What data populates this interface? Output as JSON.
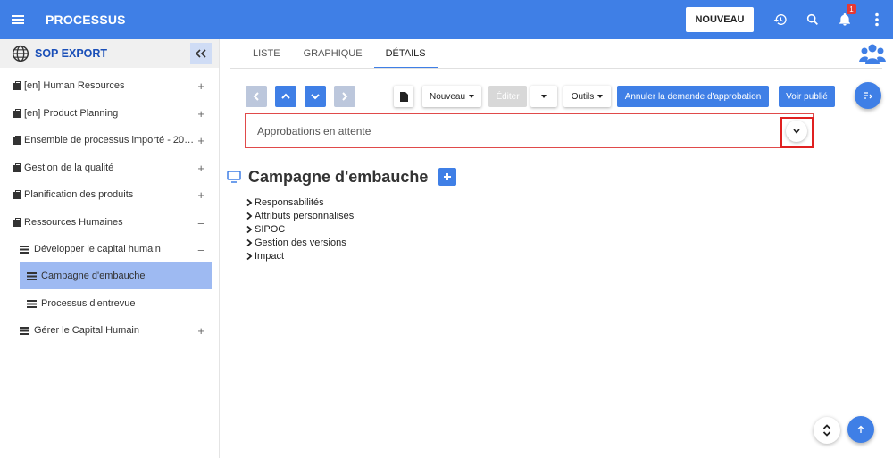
{
  "header": {
    "title": "PROCESSUS",
    "new_button": "NOUVEAU",
    "notification_count": "1",
    "icons": [
      "menu-icon",
      "history-icon",
      "search-icon",
      "bell-icon",
      "more-vert-icon"
    ]
  },
  "sidebar": {
    "title": "SOP EXPORT",
    "items": [
      {
        "label": "[en] Human Resources",
        "toggle": "+"
      },
      {
        "label": "[en] Product Planning",
        "toggle": "+"
      },
      {
        "label": "Ensemble de processus importé - 202…",
        "toggle": "+"
      },
      {
        "label": "Gestion de la qualité",
        "toggle": "+"
      },
      {
        "label": "Planification des produits",
        "toggle": "+"
      },
      {
        "label": "Ressources Humaines",
        "toggle": "–"
      },
      {
        "label": "Développer le capital humain",
        "toggle": "–"
      },
      {
        "label": "Campagne d'embauche",
        "toggle": ""
      },
      {
        "label": "Processus d'entrevue",
        "toggle": ""
      },
      {
        "label": "Gérer le Capital Humain",
        "toggle": "+"
      }
    ]
  },
  "tabs": [
    {
      "label": "LISTE"
    },
    {
      "label": "GRAPHIQUE"
    },
    {
      "label": "DÉTAILS"
    }
  ],
  "toolbar": {
    "new_dropdown": "Nouveau",
    "edit": "Éditer",
    "tools": "Outils",
    "cancel_approval": "Annuler la demande d'approbation",
    "view_published": "Voir publié"
  },
  "approvals": {
    "label": "Approbations en attente"
  },
  "process": {
    "title": "Campagne d'embauche",
    "sections": [
      {
        "label": "Responsabilités"
      },
      {
        "label": "Attributs personnalisés"
      },
      {
        "label": "SIPOC"
      },
      {
        "label": "Gestion des versions"
      },
      {
        "label": "Impact"
      }
    ]
  },
  "colors": {
    "primary": "#3f7fe6",
    "active_item": "#9ebaf2",
    "highlight_red": "#e02020"
  }
}
